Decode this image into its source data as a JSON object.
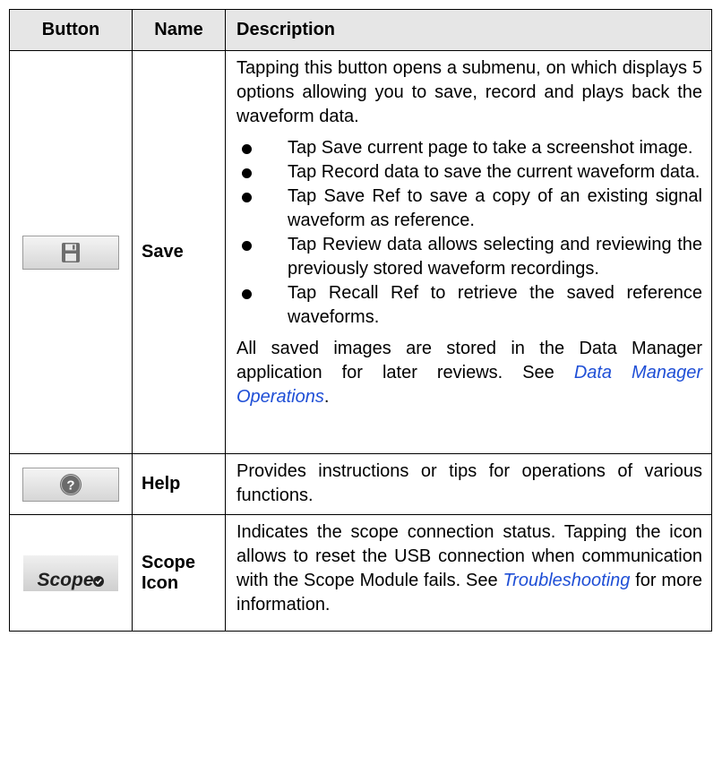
{
  "header": {
    "button": "Button",
    "name": "Name",
    "description": "Description"
  },
  "rows": [
    {
      "icon": "save-floppy-icon",
      "name": "Save",
      "intro": "Tapping this button opens a submenu, on which displays 5 options allowing you to save, record and plays back the waveform data.",
      "bullets": [
        "Tap Save current page to take a screenshot image.",
        "Tap Record data to save the current waveform data.",
        "Tap Save Ref to save a copy of an existing signal waveform as reference.",
        "Tap Review data allows selecting and reviewing the previously stored waveform recordings.",
        "Tap Recall Ref to retrieve the saved reference waveforms."
      ],
      "outro_text": "All saved images are stored in the Data Manager application for later reviews. See ",
      "outro_link": "Data Manager Operations",
      "outro_end": "."
    },
    {
      "icon": "help-question-icon",
      "name": "Help",
      "description": "Provides instructions or tips for operations of various functions."
    },
    {
      "icon": "scope-status-icon",
      "icon_text": "Scope",
      "name": "Scope Icon",
      "description_text": "Indicates the scope connection status. Tapping the icon allows to reset the USB connection when communication with the Scope Module fails. See ",
      "description_link": "Troubleshooting",
      "description_end": " for more information."
    }
  ],
  "colors": {
    "header_bg": "#e6e6e6",
    "link": "#1f4fd6"
  }
}
